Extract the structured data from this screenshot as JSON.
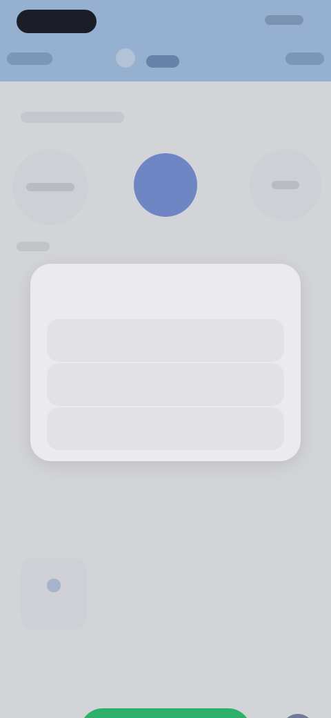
{
  "header": {
    "status_time": "",
    "nav_left": "",
    "nav_title": "",
    "nav_right": ""
  },
  "main": {
    "section_label": "",
    "sub_label": ""
  },
  "dialog": {
    "title": "",
    "options": [
      {
        "label": ""
      },
      {
        "label": ""
      }
    ],
    "cancel_label": ""
  },
  "footer": {
    "primary_label": ""
  },
  "colors": {
    "header_bg": "#95b1cf",
    "accent_blue": "#6f86c4",
    "primary_green": "#2fb06a"
  },
  "icons": {
    "profile_middle": "avatar-icon",
    "small_card": "item-icon",
    "side_button": "scan-icon"
  }
}
